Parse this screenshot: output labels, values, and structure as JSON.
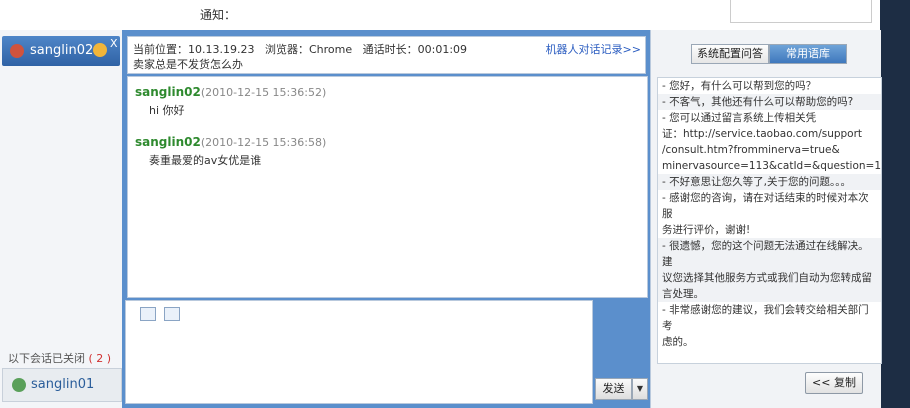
{
  "notice": {
    "label": "通知："
  },
  "sessions": {
    "active": {
      "name": "sanglin02",
      "close": "X"
    },
    "closed_label": "以下会话已关闭",
    "closed_count": "( 2 )",
    "closed": {
      "name": "sanglin01"
    }
  },
  "info_bar": {
    "location_label": "当前位置：",
    "location_value": "10.13.19.23",
    "browser_label": "浏览器：",
    "browser_value": "Chrome",
    "duration_label": "通话时长：",
    "duration_value": "00:01:09",
    "question": "卖家总是不发货怎么办",
    "robot_link": "机器人对话记录>>"
  },
  "messages": [
    {
      "sender": "sanglin02",
      "time": "(2010-12-15 15:36:52)",
      "text": "hi 你好"
    },
    {
      "sender": "sanglin02",
      "time": "(2010-12-15 15:36:58)",
      "text": "奏重最爱的av女优是谁"
    }
  ],
  "input": {
    "send_label": "发送",
    "dropdown_arrow": "▼"
  },
  "right_panel": {
    "tabs": [
      {
        "label": "系统配置问答",
        "active": false
      },
      {
        "label": "常用语库",
        "active": true
      }
    ],
    "phrases": [
      "- 您好，有什么可以帮到您的吗？",
      "- 不客气，其他还有什么可以帮助您的吗?",
      "- 您可以通过留言系统上传相关凭\n证：http://service.taobao.com/support\n/consult.htm?fromminerva=true&\nminervasource=113&catId=&question=1",
      "- 不好意思让您久等了,关于您的问题。。。",
      "- 感谢您的咨询，请在对话结束的时候对本次服\n务进行评价，谢谢!",
      "- 很遗憾，您的这个问题无法通过在线解决。建\n议您选择其他服务方式或我们自动为您转成留\n言处理。",
      "- 非常感谢您的建议，我们会转交给相关部门考\n虑的。"
    ],
    "copy_label": "<< 复制"
  },
  "colors": {
    "frame": "#5b8fcc",
    "sender": "#2f8a2f",
    "link": "#2a5cc0",
    "count": "#d03030"
  }
}
